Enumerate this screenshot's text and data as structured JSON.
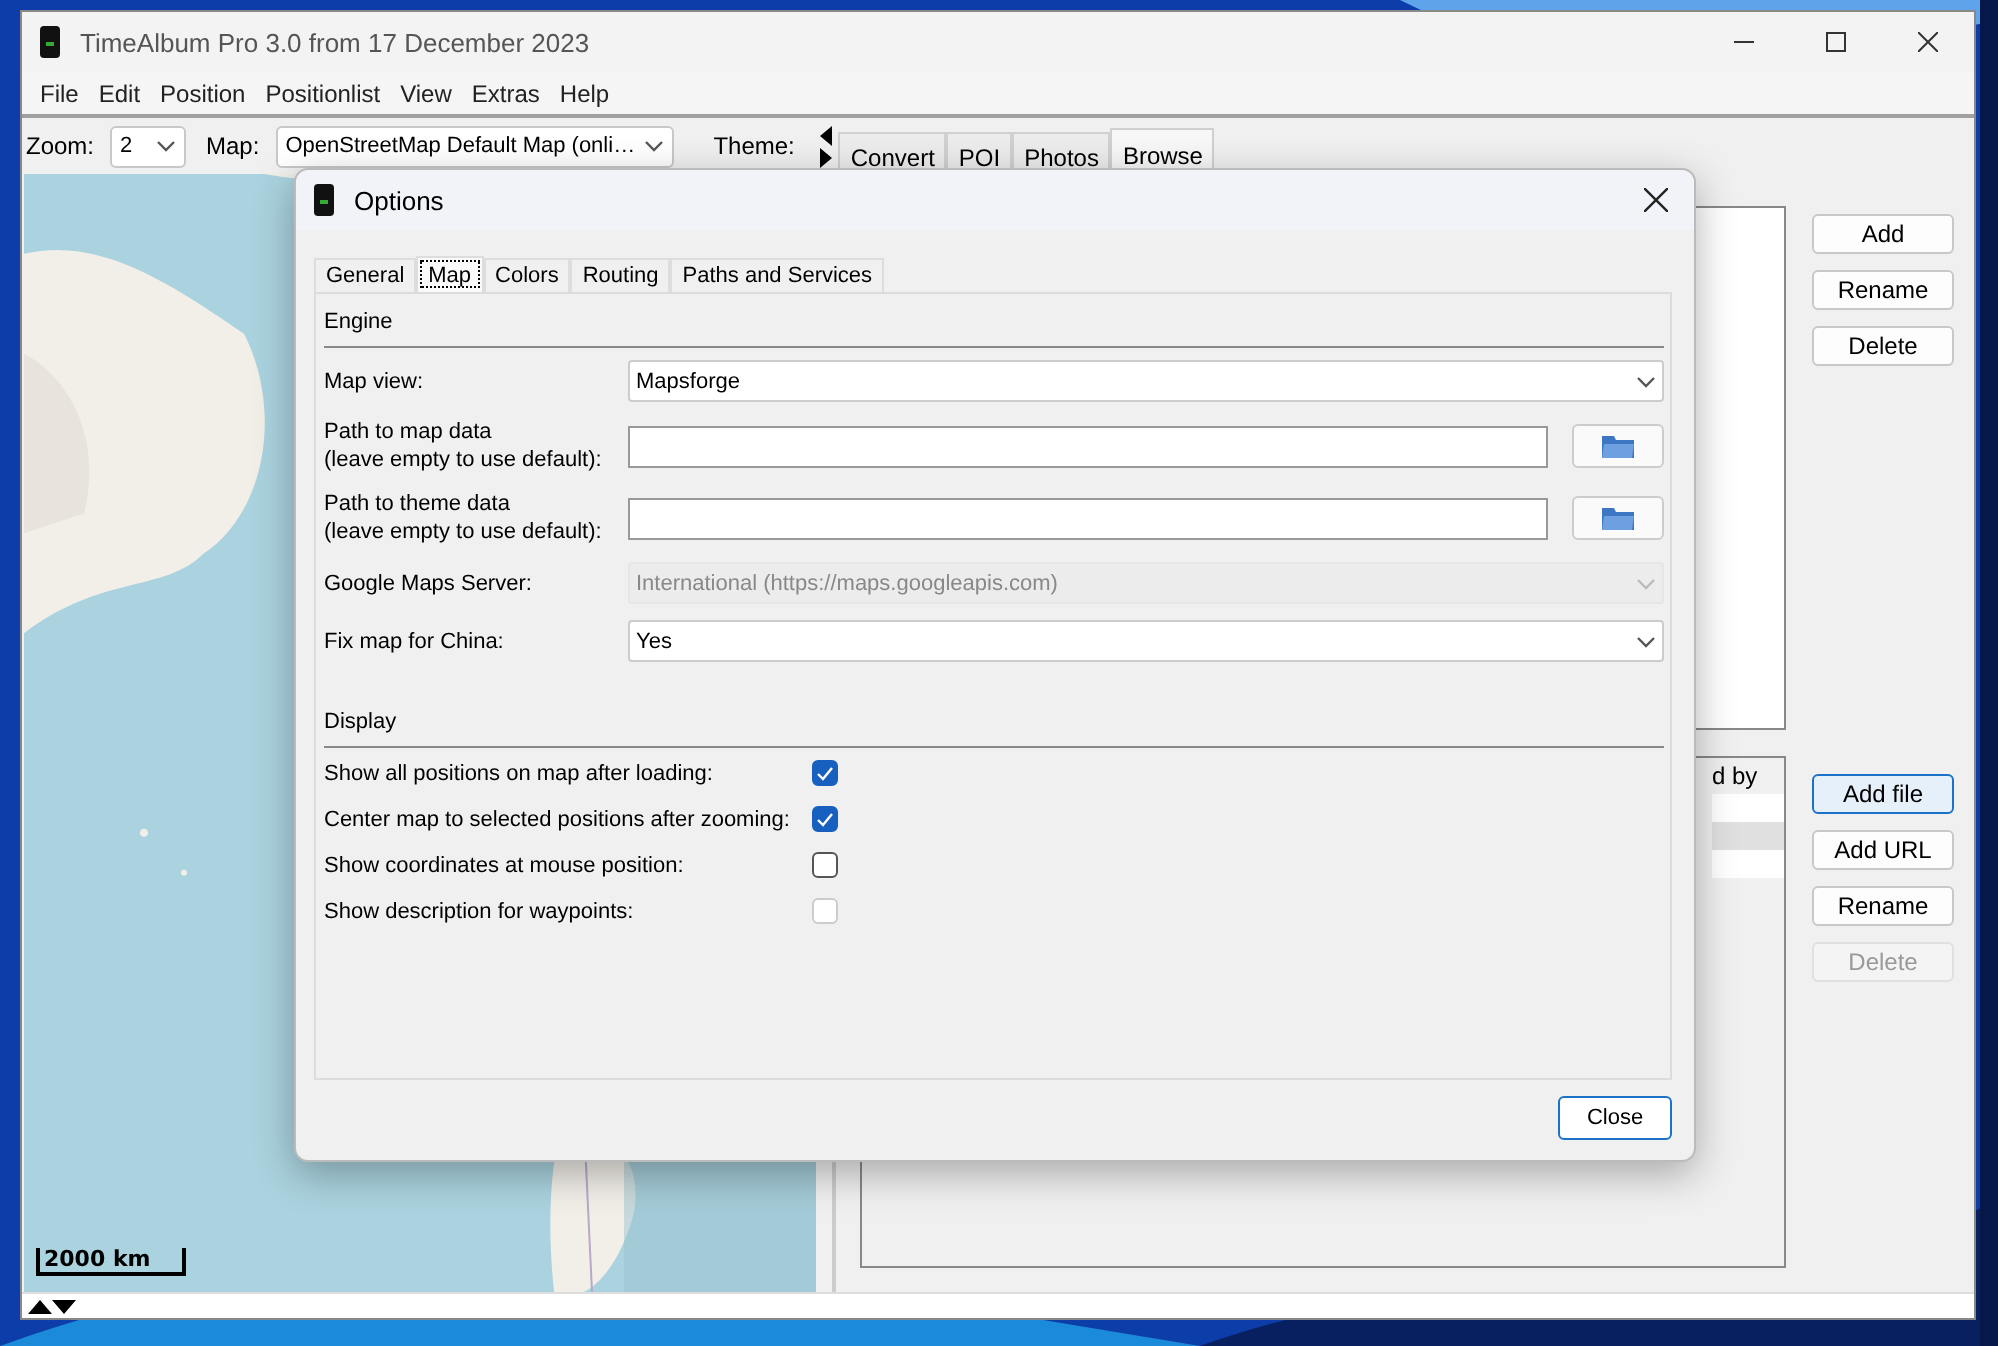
{
  "window": {
    "title": "TimeAlbum Pro 3.0 from 17 December 2023"
  },
  "menu": [
    "File",
    "Edit",
    "Position",
    "Positionlist",
    "View",
    "Extras",
    "Help"
  ],
  "toolbar": {
    "zoom_label": "Zoom:",
    "zoom_value": "2",
    "map_label": "Map:",
    "map_value": "OpenStreetMap Default Map (onli…",
    "theme_label": "Theme:"
  },
  "tabs": [
    {
      "label": "Convert",
      "selected": false
    },
    {
      "label": "POI",
      "selected": false
    },
    {
      "label": "Photos",
      "selected": false
    },
    {
      "label": "Browse",
      "selected": true
    }
  ],
  "map": {
    "scale": "2000 km"
  },
  "top_buttons": [
    {
      "label": "Add",
      "focused": false,
      "disabled": false
    },
    {
      "label": "Rename",
      "focused": false,
      "disabled": false
    },
    {
      "label": "Delete",
      "focused": false,
      "disabled": false
    }
  ],
  "file_list": {
    "column": "d by"
  },
  "file_buttons": [
    {
      "label": "Add file",
      "focused": true,
      "disabled": false
    },
    {
      "label": "Add URL",
      "focused": false,
      "disabled": false
    },
    {
      "label": "Rename",
      "focused": false,
      "disabled": false
    },
    {
      "label": "Delete",
      "focused": false,
      "disabled": true
    }
  ],
  "dialog": {
    "title": "Options",
    "tabs": [
      {
        "label": "General",
        "selected": false
      },
      {
        "label": "Map",
        "selected": true
      },
      {
        "label": "Colors",
        "selected": false
      },
      {
        "label": "Routing",
        "selected": false
      },
      {
        "label": "Paths and Services",
        "selected": false
      }
    ],
    "engine": {
      "heading": "Engine",
      "rows": [
        {
          "kind": "select",
          "label": "Map view:",
          "value": "Mapsforge",
          "disabled": false
        },
        {
          "kind": "path",
          "label": "Path to map data\n(leave empty to use default):"
        },
        {
          "kind": "path",
          "label": "Path to theme data\n(leave empty to use default):"
        },
        {
          "kind": "select",
          "label": "Google Maps Server:",
          "value": "International (https://maps.googleapis.com)",
          "disabled": true
        },
        {
          "kind": "select",
          "label": "Fix map for China:",
          "value": "Yes",
          "disabled": false
        }
      ]
    },
    "display": {
      "heading": "Display",
      "options": [
        {
          "label": "Show all positions on map after loading:",
          "checked": true,
          "disabled": false
        },
        {
          "label": "Center map to selected positions after zooming:",
          "checked": true,
          "disabled": false
        },
        {
          "label": "Show coordinates at mouse position:",
          "checked": false,
          "disabled": false
        },
        {
          "label": "Show description for waypoints:",
          "checked": false,
          "disabled": true
        }
      ]
    },
    "close_button": "Close"
  }
}
